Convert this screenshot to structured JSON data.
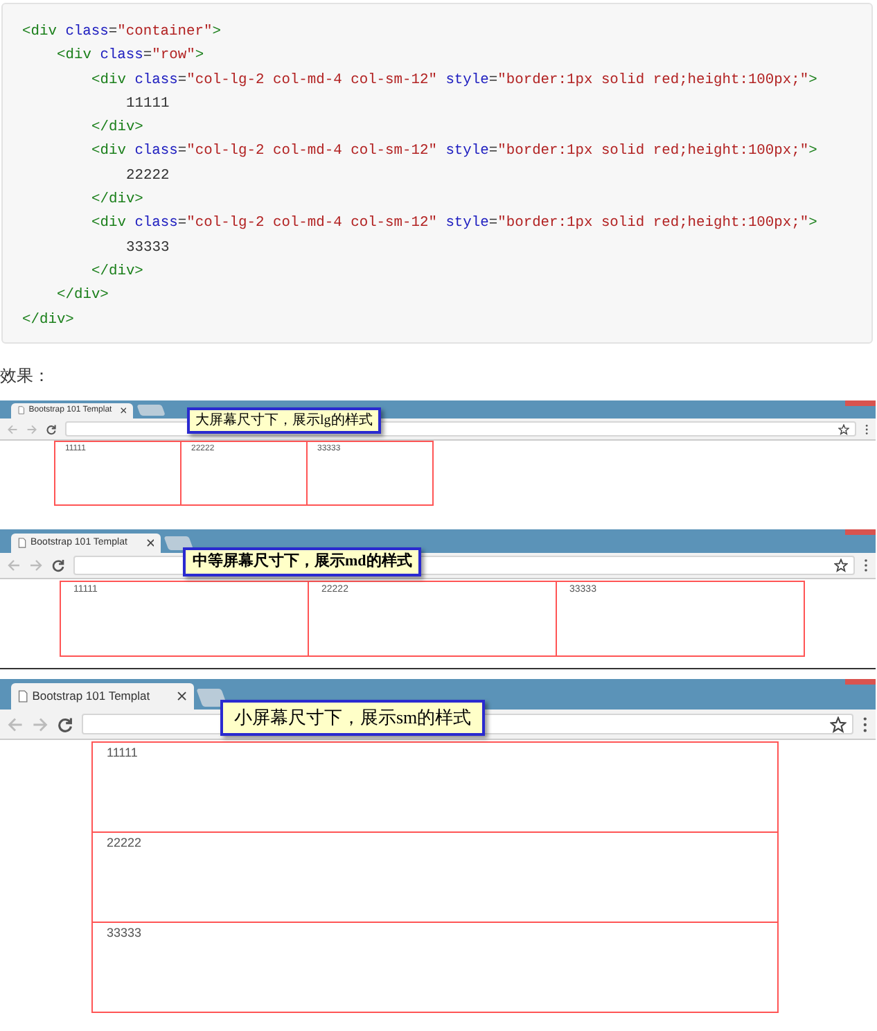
{
  "code_block": {
    "lines": [
      {
        "segments": [
          {
            "kind": "tag",
            "text": "<div "
          },
          {
            "kind": "attr",
            "text": "class"
          },
          {
            "kind": "plain",
            "text": "="
          },
          {
            "kind": "value",
            "text": "\"container\""
          },
          {
            "kind": "tag",
            "text": ">"
          }
        ],
        "children": [
          {
            "segments": [
              {
                "kind": "tag",
                "text": "<div "
              },
              {
                "kind": "attr",
                "text": "class"
              },
              {
                "kind": "plain",
                "text": "="
              },
              {
                "kind": "value",
                "text": "\"row\""
              },
              {
                "kind": "tag",
                "text": ">"
              }
            ],
            "children": [
              {
                "segments": [
                  {
                    "kind": "tag",
                    "text": "<div "
                  },
                  {
                    "kind": "attr",
                    "text": "class"
                  },
                  {
                    "kind": "plain",
                    "text": "="
                  },
                  {
                    "kind": "value",
                    "text": "\"col-lg-2 col-md-4 col-sm-12\" "
                  },
                  {
                    "kind": "attr",
                    "text": "style"
                  },
                  {
                    "kind": "plain",
                    "text": "="
                  },
                  {
                    "kind": "value",
                    "text": "\"border:1px solid red;height:100px;\""
                  },
                  {
                    "kind": "tag",
                    "text": ">"
                  }
                ],
                "children": [
                  {
                    "segments": [
                      {
                        "kind": "plain",
                        "text": "11111"
                      }
                    ]
                  }
                ]
              },
              {
                "segments": [
                  {
                    "kind": "tag",
                    "text": "</div>"
                  }
                ]
              },
              {
                "segments": [
                  {
                    "kind": "tag",
                    "text": "<div "
                  },
                  {
                    "kind": "attr",
                    "text": "class"
                  },
                  {
                    "kind": "plain",
                    "text": "="
                  },
                  {
                    "kind": "value",
                    "text": "\"col-lg-2 col-md-4 col-sm-12\" "
                  },
                  {
                    "kind": "attr",
                    "text": "style"
                  },
                  {
                    "kind": "plain",
                    "text": "="
                  },
                  {
                    "kind": "value",
                    "text": "\"border:1px solid red;height:100px;\""
                  },
                  {
                    "kind": "tag",
                    "text": ">"
                  }
                ],
                "children": [
                  {
                    "segments": [
                      {
                        "kind": "plain",
                        "text": "22222"
                      }
                    ]
                  }
                ]
              },
              {
                "segments": [
                  {
                    "kind": "tag",
                    "text": "</div>"
                  }
                ]
              },
              {
                "segments": [
                  {
                    "kind": "tag",
                    "text": "<div "
                  },
                  {
                    "kind": "attr",
                    "text": "class"
                  },
                  {
                    "kind": "plain",
                    "text": "="
                  },
                  {
                    "kind": "value",
                    "text": "\"col-lg-2 col-md-4 col-sm-12\" "
                  },
                  {
                    "kind": "attr",
                    "text": "style"
                  },
                  {
                    "kind": "plain",
                    "text": "="
                  },
                  {
                    "kind": "value",
                    "text": "\"border:1px solid red;height:100px;\""
                  },
                  {
                    "kind": "tag",
                    "text": ">"
                  }
                ],
                "children": [
                  {
                    "segments": [
                      {
                        "kind": "plain",
                        "text": "33333"
                      }
                    ]
                  }
                ]
              },
              {
                "segments": [
                  {
                    "kind": "tag",
                    "text": "</div>"
                  }
                ]
              }
            ]
          },
          {
            "segments": [
              {
                "kind": "tag",
                "text": "</div>"
              }
            ]
          }
        ]
      },
      {
        "segments": [
          {
            "kind": "tag",
            "text": "</div>"
          }
        ]
      }
    ]
  },
  "result_label": "效果：",
  "screenshots": [
    {
      "kind": "large",
      "tab_title": "Bootstrap 101 Templat",
      "callout": "大屏幕尺寸下，展示lg的样式",
      "cells": [
        "11111",
        "22222",
        "33333"
      ]
    },
    {
      "kind": "medium",
      "tab_title": "Bootstrap 101 Templat",
      "callout": "中等屏幕尺寸下，展示md的样式",
      "cells": [
        "11111",
        "22222",
        "33333"
      ]
    },
    {
      "kind": "small",
      "tab_title": "Bootstrap 101 Templat",
      "callout": "小屏幕尺寸下，展示sm的样式",
      "cells": [
        "11111",
        "22222",
        "33333"
      ]
    }
  ]
}
